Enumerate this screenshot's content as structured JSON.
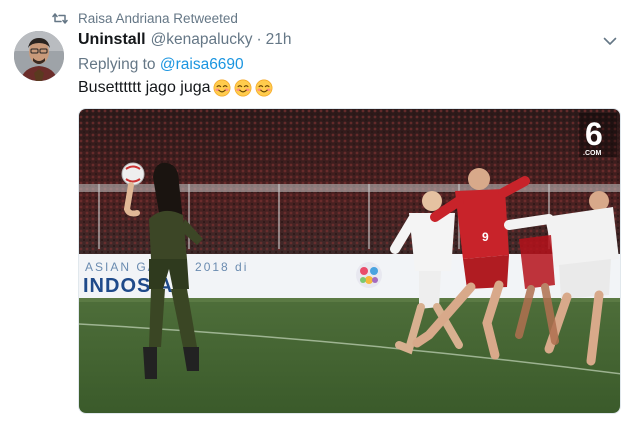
{
  "retweet": {
    "icon": "retweet-icon",
    "text": "Raisa Andriana Retweeted"
  },
  "author": {
    "display_name": "Uninstall",
    "handle": "@kenapalucky",
    "separator": "·",
    "time": "21h"
  },
  "reply": {
    "prefix": "Replying to ",
    "handle": "@raisa6690"
  },
  "tweet": {
    "text": "Busetttttt jago juga",
    "emoji": [
      "smiling-face-with-smiling-eyes",
      "smiling-face-with-smiling-eyes",
      "smiling-face-with-smiling-eyes"
    ]
  },
  "media": {
    "banner_text_top": "ASIAN GAMES 2018 di",
    "banner_text_bottom": "INDOSIAR",
    "player_number": "9",
    "watermark": "6",
    "watermark_sub": ".COM"
  },
  "colors": {
    "link": "#1b95e0",
    "muted": "#657786",
    "text": "#14171a"
  }
}
